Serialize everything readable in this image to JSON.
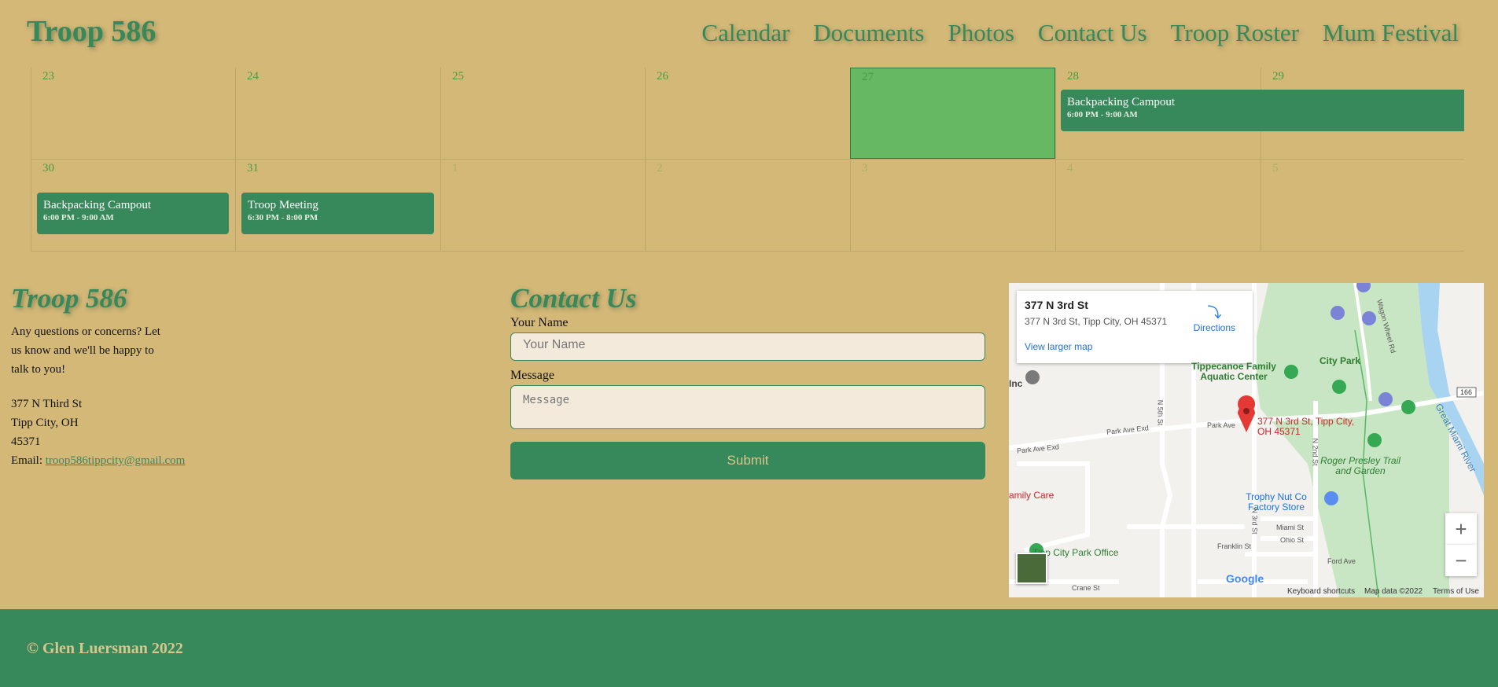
{
  "header": {
    "brand": "Troop 586",
    "nav": [
      "Calendar",
      "Documents",
      "Photos",
      "Contact Us",
      "Troop Roster",
      "Mum Festival"
    ]
  },
  "calendar": {
    "weeks": [
      {
        "days": [
          "23",
          "24",
          "25",
          "26",
          "27",
          "28",
          "29"
        ]
      },
      {
        "days": [
          "30",
          "31",
          "1",
          "2",
          "3",
          "4",
          "5"
        ]
      }
    ],
    "events": [
      {
        "title": "Backpacking Campout",
        "time": "6:00 PM - 9:00 AM"
      },
      {
        "title": "Backpacking Campout",
        "time": "6:00 PM - 9:00 AM"
      },
      {
        "title": "Troop Meeting",
        "time": "6:30 PM - 8:00 PM"
      }
    ]
  },
  "about": {
    "title": "Troop 586",
    "intro": "Any questions or concerns? Let us know and we'll be happy to talk to you!",
    "address_line1": "377 N Third St",
    "address_line2": "Tipp City, OH",
    "address_line3": "45371",
    "email_label": "Email: ",
    "email": "troop586tippcity@gmail.com"
  },
  "contact": {
    "title": "Contact Us",
    "name_label": "Your Name",
    "name_placeholder": "Your Name",
    "message_label": "Message",
    "message_placeholder": "Message",
    "submit_label": "Submit"
  },
  "map": {
    "card_title": "377 N 3rd St",
    "card_address": "377 N 3rd St, Tipp City, OH 45371",
    "directions": "Directions",
    "larger_map": "View larger map",
    "labels": {
      "aquatic": "Tippecanoe Family Aquatic Center",
      "city_park": "City Park",
      "inc": "Inc",
      "pin": "377 N 3rd St, Tipp City, OH 45371",
      "presley": "Roger Presley Trail and Garden",
      "trophy": "Trophy Nut Co Factory Store",
      "family_care": "amily Care",
      "park_office": "Tipp City Park Office",
      "park_ave": "Park Ave",
      "park_ave_exd": "Park Ave Exd",
      "park_ave_exd2": "Park Ave Exd",
      "n5th": "N 5th St",
      "n3rd": "N 3rd St",
      "n2nd": "N 2nd St",
      "miami": "Miami St",
      "ohio": "Ohio St",
      "franklin": "Franklin St",
      "ford": "Ford Ave",
      "crane": "Crane St",
      "wagon": "Wagon Wheel Rd",
      "great_miami": "Great Miami River",
      "route": "166"
    },
    "keyboard": "Keyboard shortcuts",
    "mapdata": "Map data ©2022",
    "terms": "Terms of Use",
    "google": "Google",
    "accent": "#1a73e8",
    "pin_color": "#e53935"
  },
  "footer": {
    "copyright": "© Glen Luersman 2022"
  },
  "colors": {
    "primary": "#37885a",
    "background": "#d4b878",
    "today": "#66b862"
  }
}
